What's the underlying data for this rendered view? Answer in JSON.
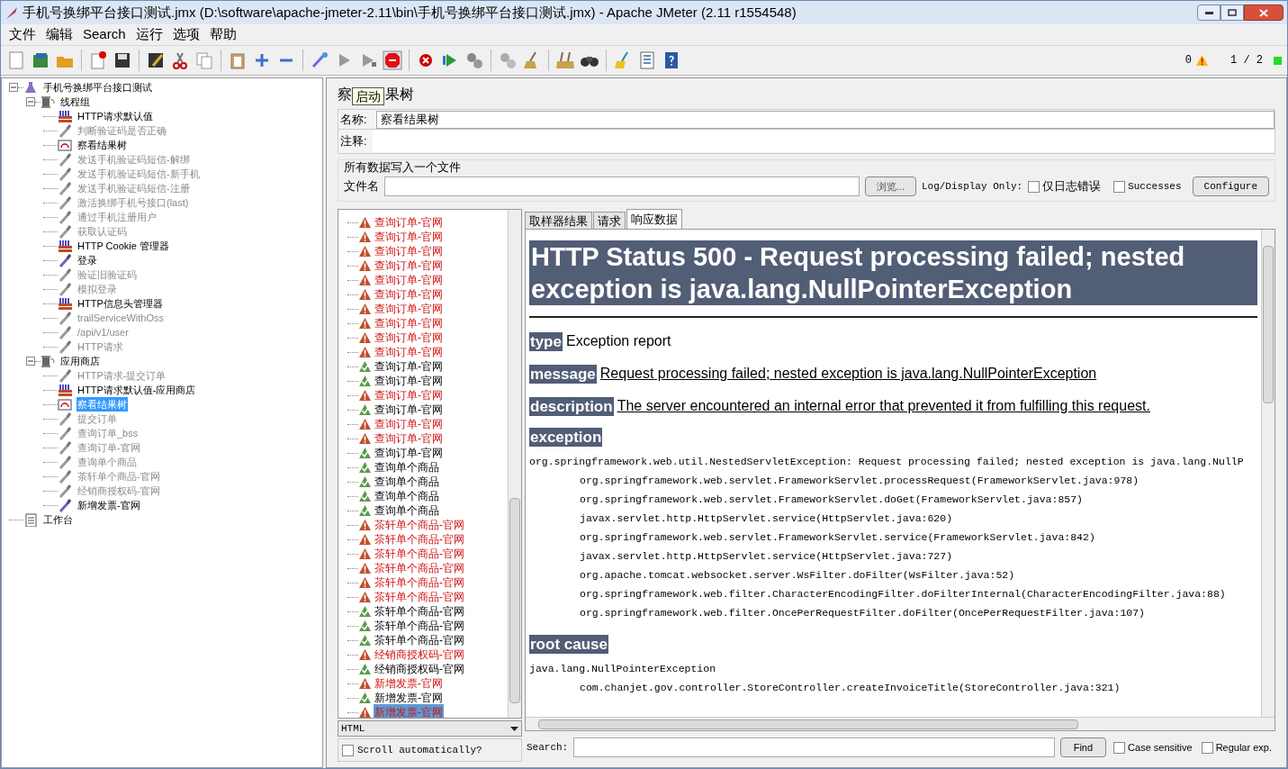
{
  "window": {
    "title": "手机号换绑平台接口测试.jmx (D:\\software\\apache-jmeter-2.11\\bin\\手机号换绑平台接口测试.jmx) - Apache JMeter (2.11 r1554548)"
  },
  "menu": [
    "文件",
    "编辑",
    "Search",
    "运行",
    "选项",
    "帮助"
  ],
  "status": {
    "warning_count": "0",
    "threads": "1 / 2"
  },
  "tree": [
    {
      "label": "手机号换绑平台接口测试",
      "kind": "plan",
      "enabled": true,
      "selected": false,
      "expanded": true,
      "children": [
        {
          "label": "线程组",
          "kind": "threadgroup",
          "enabled": true,
          "selected": false,
          "expanded": true,
          "children": [
            {
              "label": "HTTP请求默认值",
              "kind": "config",
              "enabled": true,
              "selected": false
            },
            {
              "label": "判断验证码是否正确",
              "kind": "sampler",
              "enabled": false,
              "selected": false
            },
            {
              "label": "察看结果树",
              "kind": "listener",
              "enabled": true,
              "selected": false
            },
            {
              "label": "发送手机验证码短信-解绑",
              "kind": "sampler",
              "enabled": false,
              "selected": false
            },
            {
              "label": "发送手机验证码短信-新手机",
              "kind": "sampler",
              "enabled": false,
              "selected": false
            },
            {
              "label": "发送手机验证码短信-注册",
              "kind": "sampler",
              "enabled": false,
              "selected": false
            },
            {
              "label": "激活换绑手机号接口(last)",
              "kind": "sampler",
              "enabled": false,
              "selected": false
            },
            {
              "label": "通过手机注册用户",
              "kind": "sampler",
              "enabled": false,
              "selected": false
            },
            {
              "label": "获取认证码",
              "kind": "sampler",
              "enabled": false,
              "selected": false
            },
            {
              "label": "HTTP Cookie 管理器",
              "kind": "config",
              "enabled": true,
              "selected": false
            },
            {
              "label": "登录",
              "kind": "sampler",
              "enabled": true,
              "selected": false
            },
            {
              "label": "验证旧验证码",
              "kind": "sampler",
              "enabled": false,
              "selected": false
            },
            {
              "label": "模拟登录",
              "kind": "sampler",
              "enabled": false,
              "selected": false
            },
            {
              "label": "HTTP信息头管理器",
              "kind": "config",
              "enabled": true,
              "selected": false
            },
            {
              "label": "trailServiceWithOss",
              "kind": "sampler",
              "enabled": false,
              "selected": false
            },
            {
              "label": "/api/v1/user",
              "kind": "sampler",
              "enabled": false,
              "selected": false
            },
            {
              "label": "HTTP请求",
              "kind": "sampler",
              "enabled": false,
              "selected": false
            }
          ]
        },
        {
          "label": "应用商店",
          "kind": "threadgroup",
          "enabled": true,
          "selected": false,
          "expanded": true,
          "children": [
            {
              "label": "HTTP请求-提交订单",
              "kind": "sampler",
              "enabled": false,
              "selected": false
            },
            {
              "label": "HTTP请求默认值-应用商店",
              "kind": "config",
              "enabled": true,
              "selected": false
            },
            {
              "label": "察看结果树",
              "kind": "listener",
              "enabled": true,
              "selected": true
            },
            {
              "label": "提交订单",
              "kind": "sampler",
              "enabled": false,
              "selected": false
            },
            {
              "label": "查询订单_bss",
              "kind": "sampler",
              "enabled": false,
              "selected": false
            },
            {
              "label": "查询订单-官网",
              "kind": "sampler",
              "enabled": false,
              "selected": false
            },
            {
              "label": "查询单个商品",
              "kind": "sampler",
              "enabled": false,
              "selected": false
            },
            {
              "label": "茶轩单个商品-官网",
              "kind": "sampler",
              "enabled": false,
              "selected": false
            },
            {
              "label": "经销商授权码-官网",
              "kind": "sampler",
              "enabled": false,
              "selected": false
            },
            {
              "label": "新增发票-官网",
              "kind": "sampler",
              "enabled": true,
              "selected": false
            }
          ]
        }
      ]
    },
    {
      "label": "工作台",
      "kind": "workbench",
      "enabled": true,
      "selected": false
    }
  ],
  "editor": {
    "title_left": "察",
    "tooltip": "启动",
    "title_right": "果树",
    "name_label": "名称:",
    "name_value": "察看结果树",
    "comment_label": "注释:",
    "file_group": "所有数据写入一个文件",
    "file_label": "文件名",
    "browse": "浏览...",
    "log_only_label": "Log/Display Only:",
    "errors_only": {
      "label": "仅日志错误",
      "checked": false
    },
    "successes": {
      "label": "Successes",
      "checked": false
    },
    "configure": "Configure"
  },
  "results": [
    {
      "label": "查询订单-官网",
      "ok": false,
      "selected": false
    },
    {
      "label": "查询订单-官网",
      "ok": false,
      "selected": false
    },
    {
      "label": "查询订单-官网",
      "ok": false,
      "selected": false
    },
    {
      "label": "查询订单-官网",
      "ok": false,
      "selected": false
    },
    {
      "label": "查询订单-官网",
      "ok": false,
      "selected": false
    },
    {
      "label": "查询订单-官网",
      "ok": false,
      "selected": false
    },
    {
      "label": "查询订单-官网",
      "ok": false,
      "selected": false
    },
    {
      "label": "查询订单-官网",
      "ok": false,
      "selected": false
    },
    {
      "label": "查询订单-官网",
      "ok": false,
      "selected": false
    },
    {
      "label": "查询订单-官网",
      "ok": false,
      "selected": false
    },
    {
      "label": "查询订单-官网",
      "ok": true,
      "selected": false
    },
    {
      "label": "查询订单-官网",
      "ok": true,
      "selected": false
    },
    {
      "label": "查询订单-官网",
      "ok": false,
      "selected": false
    },
    {
      "label": "查询订单-官网",
      "ok": true,
      "selected": false
    },
    {
      "label": "查询订单-官网",
      "ok": false,
      "selected": false
    },
    {
      "label": "查询订单-官网",
      "ok": false,
      "selected": false
    },
    {
      "label": "查询订单-官网",
      "ok": true,
      "selected": false
    },
    {
      "label": "查询单个商品",
      "ok": true,
      "selected": false
    },
    {
      "label": "查询单个商品",
      "ok": true,
      "selected": false
    },
    {
      "label": "查询单个商品",
      "ok": true,
      "selected": false
    },
    {
      "label": "查询单个商品",
      "ok": true,
      "selected": false
    },
    {
      "label": "茶轩单个商品-官网",
      "ok": false,
      "selected": false
    },
    {
      "label": "茶轩单个商品-官网",
      "ok": false,
      "selected": false
    },
    {
      "label": "茶轩单个商品-官网",
      "ok": false,
      "selected": false
    },
    {
      "label": "茶轩单个商品-官网",
      "ok": false,
      "selected": false
    },
    {
      "label": "茶轩单个商品-官网",
      "ok": false,
      "selected": false
    },
    {
      "label": "茶轩单个商品-官网",
      "ok": false,
      "selected": false
    },
    {
      "label": "茶轩单个商品-官网",
      "ok": true,
      "selected": false
    },
    {
      "label": "茶轩单个商品-官网",
      "ok": true,
      "selected": false
    },
    {
      "label": "茶轩单个商品-官网",
      "ok": true,
      "selected": false
    },
    {
      "label": "经销商授权码-官网",
      "ok": false,
      "selected": false
    },
    {
      "label": "经销商授权码-官网",
      "ok": true,
      "selected": false
    },
    {
      "label": "新增发票-官网",
      "ok": false,
      "selected": false
    },
    {
      "label": "新增发票-官网",
      "ok": true,
      "selected": false
    },
    {
      "label": "新增发票-官网",
      "ok": false,
      "selected": true
    }
  ],
  "renderer": "HTML",
  "scroll_auto": {
    "label": "Scroll automatically?",
    "checked": false
  },
  "tabs": [
    {
      "label": "取样器结果",
      "selected": false
    },
    {
      "label": "请求",
      "selected": false
    },
    {
      "label": "响应数据",
      "selected": true
    }
  ],
  "response": {
    "heading": "HTTP Status 500 - Request processing failed; nested exception is java.lang.NullPointerException",
    "fields": [
      {
        "label": "type",
        "text": "Exception report",
        "underlined": false
      },
      {
        "label": "message",
        "text": "Request processing failed; nested exception is java.lang.NullPointerException",
        "underlined": true
      },
      {
        "label": "description",
        "text": "The server encountered an internal error that prevented it from fulfilling this request.",
        "underlined": true
      }
    ],
    "sections": [
      {
        "label": "exception",
        "head": "org.springframework.web.util.NestedServletException: Request processing failed; nested exception is java.lang.NullP",
        "lines": [
          "org.springframework.web.servlet.FrameworkServlet.processRequest(FrameworkServlet.java:978)",
          "org.springframework.web.servlet.FrameworkServlet.doGet(FrameworkServlet.java:857)",
          "javax.servlet.http.HttpServlet.service(HttpServlet.java:620)",
          "org.springframework.web.servlet.FrameworkServlet.service(FrameworkServlet.java:842)",
          "javax.servlet.http.HttpServlet.service(HttpServlet.java:727)",
          "org.apache.tomcat.websocket.server.WsFilter.doFilter(WsFilter.java:52)",
          "org.springframework.web.filter.CharacterEncodingFilter.doFilterInternal(CharacterEncodingFilter.java:88)",
          "org.springframework.web.filter.OncePerRequestFilter.doFilter(OncePerRequestFilter.java:107)"
        ]
      },
      {
        "label": "root cause",
        "head": "java.lang.NullPointerException",
        "lines": [
          "com.chanjet.gov.controller.StoreController.createInvoiceTitle(StoreController.java:321)"
        ]
      }
    ]
  },
  "search": {
    "label": "Search:",
    "find": "Find",
    "case_sensitive": {
      "label": "Case sensitive",
      "checked": false
    },
    "regex": {
      "label": "Regular exp.",
      "checked": false
    }
  }
}
